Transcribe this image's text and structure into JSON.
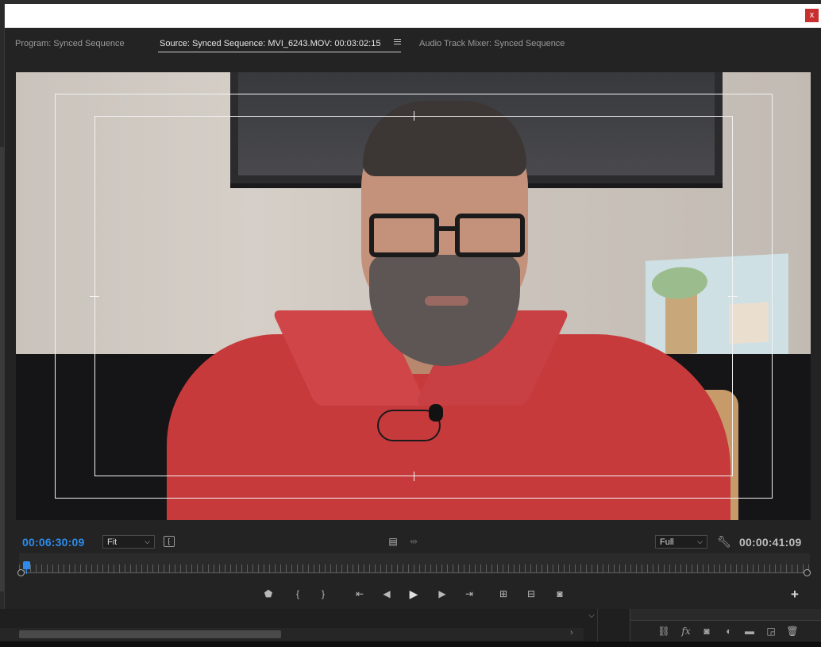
{
  "window": {
    "close_label": "x"
  },
  "tabs": [
    {
      "label": "Program: Synced Sequence",
      "active": false
    },
    {
      "label": "Source: Synced Sequence: MVI_6243.MOV: 00:03:02:15",
      "active": true
    },
    {
      "label": "Audio Track Mixer: Synced Sequence",
      "active": false
    }
  ],
  "controls": {
    "current_timecode": "00:06:30:09",
    "zoom_select": "Fit",
    "resolution_select": "Full",
    "duration_timecode": "00:00:41:09"
  },
  "timeline": {
    "playhead_fraction": 0.005
  },
  "transport": {
    "buttons": [
      {
        "name": "add-marker-icon",
        "glyph": "⬟"
      },
      {
        "name": "mark-in-icon",
        "glyph": "{"
      },
      {
        "name": "mark-out-icon",
        "glyph": "}"
      },
      {
        "name": "go-to-in-icon",
        "glyph": "⇤"
      },
      {
        "name": "step-back-icon",
        "glyph": "◀"
      },
      {
        "name": "play-icon",
        "glyph": "▶"
      },
      {
        "name": "step-forward-icon",
        "glyph": "▶"
      },
      {
        "name": "go-to-out-icon",
        "glyph": "⇥"
      },
      {
        "name": "insert-icon",
        "glyph": "⊞"
      },
      {
        "name": "overwrite-icon",
        "glyph": "⊟"
      },
      {
        "name": "export-frame-icon",
        "glyph": "◙"
      }
    ],
    "add_button": "+"
  },
  "project_toolbar": {
    "icons": [
      "link-icon",
      "fx-icon",
      "mask-icon",
      "color-icon",
      "folder-icon",
      "new-item-icon",
      "trash-icon"
    ],
    "fx_label": "fx"
  },
  "colors": {
    "accent_blue": "#2d8ceb",
    "close_red": "#c8302f",
    "panel_bg": "#232323"
  }
}
